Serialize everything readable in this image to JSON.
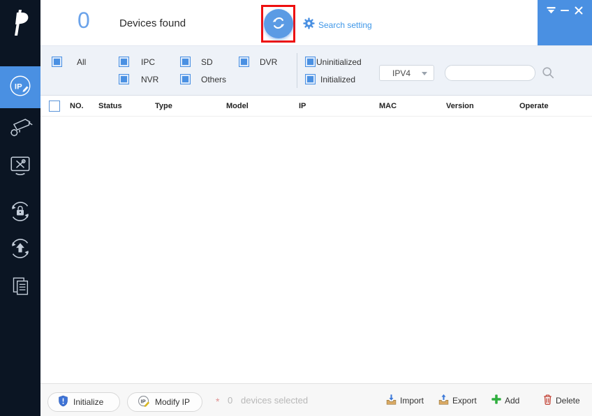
{
  "colors": {
    "accent_blue": "#4a90e2",
    "sidebar_bg": "#0b1523",
    "filter_bar_bg": "#eef2f8",
    "annotation_red": "#ee0f0f",
    "count_blue": "#6ba3ea",
    "muted_gray": "#b8b8b8",
    "add_green": "#2fae3e",
    "delete_red": "#c0392b"
  },
  "header": {
    "device_count": "0",
    "device_count_label": "Devices found",
    "search_setting_label": "Search setting"
  },
  "titlebar": {
    "icons": [
      "collapse-triangle",
      "minimize-dash",
      "close-x"
    ]
  },
  "sidebar": {
    "items": [
      {
        "id": "modify-ip",
        "icon": "ip-edit-circle-icon",
        "active": true
      },
      {
        "id": "device-config",
        "icon": "camera-gear-icon",
        "active": false
      },
      {
        "id": "system-tools",
        "icon": "monitor-tools-icon",
        "active": false
      },
      {
        "id": "password-reset",
        "icon": "lock-sync-icon",
        "active": false
      },
      {
        "id": "upgrade",
        "icon": "arrow-up-sync-icon",
        "active": false
      },
      {
        "id": "logs",
        "icon": "documents-icon",
        "active": false
      }
    ]
  },
  "filters": {
    "device_types": [
      {
        "label": "All",
        "checked": true
      },
      {
        "label": "IPC",
        "checked": true
      },
      {
        "label": "NVR",
        "checked": true
      },
      {
        "label": "SD",
        "checked": true
      },
      {
        "label": "Others",
        "checked": true
      },
      {
        "label": "DVR",
        "checked": true
      }
    ],
    "init_states": [
      {
        "label": "Uninitialized",
        "checked": true
      },
      {
        "label": "Initialized",
        "checked": true
      }
    ],
    "ip_version_selected": "IPV4",
    "search_value": "",
    "search_placeholder": ""
  },
  "table": {
    "columns": [
      "NO.",
      "Status",
      "Type",
      "Model",
      "IP",
      "MAC",
      "Version",
      "Operate"
    ],
    "rows": []
  },
  "footer": {
    "initialize_label": "Initialize",
    "modify_ip_label": "Modify IP",
    "required_marker": "*",
    "selected_count": "0",
    "selected_label": "devices selected",
    "import_label": "Import",
    "export_label": "Export",
    "add_label": "Add",
    "delete_label": "Delete"
  }
}
